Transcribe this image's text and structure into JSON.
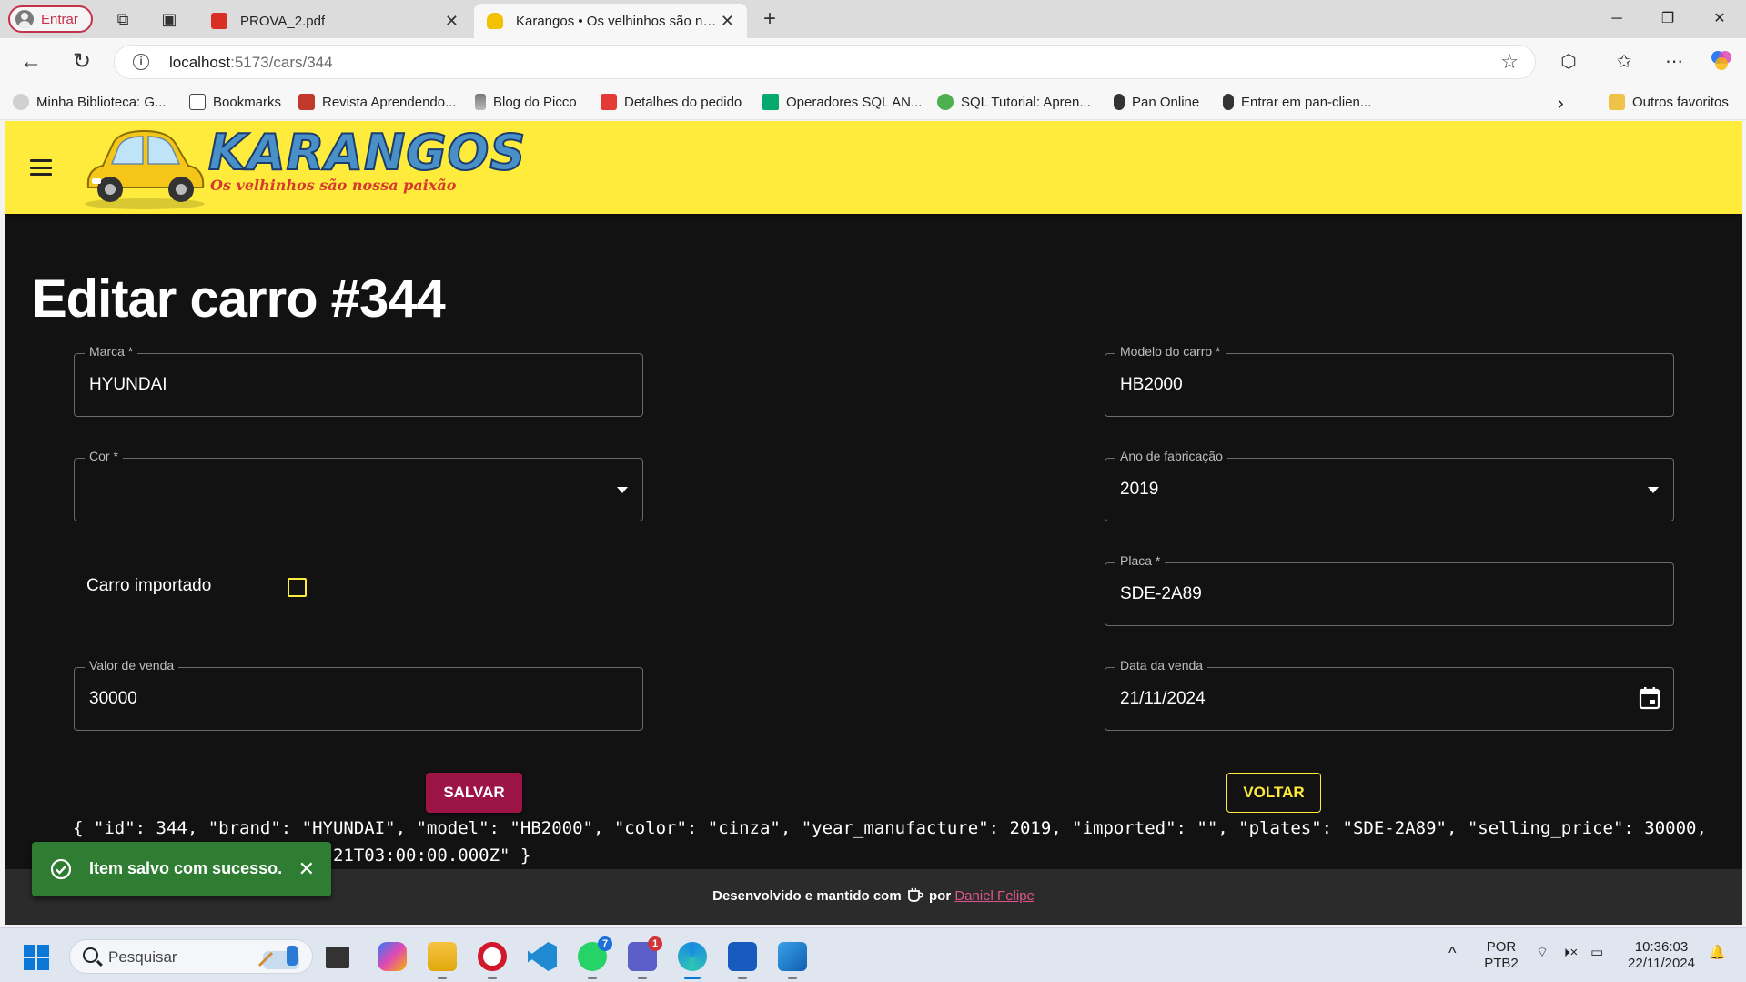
{
  "browser": {
    "profile_label": "Entrar",
    "tabs": [
      {
        "title": "PROVA_2.pdf",
        "active": false
      },
      {
        "title": "Karangos • Os velhinhos são nossa paixão",
        "active": true
      }
    ],
    "url_host": "localhost",
    "url_path": ":5173/cars/344",
    "bookmarks": [
      {
        "label": "Minha Biblioteca: G...",
        "icon": "cloud-icon"
      },
      {
        "label": "Bookmarks",
        "icon": "page-icon"
      },
      {
        "label": "Revista Aprendendo...",
        "icon": "book-icon"
      },
      {
        "label": "Blog do Picco",
        "icon": "tower-icon"
      },
      {
        "label": "Detalhes do pedido",
        "icon": "shop-icon"
      },
      {
        "label": "Operadores SQL AN...",
        "icon": "w3-icon"
      },
      {
        "label": "SQL Tutorial: Apren...",
        "icon": "sql-icon"
      },
      {
        "label": "Pan Online",
        "icon": "pan-icon"
      },
      {
        "label": "Entrar em pan-clien...",
        "icon": "pan-icon"
      }
    ],
    "other_favorites": "Outros favoritos"
  },
  "app": {
    "logo_title": "KARANGOS",
    "logo_subtitle": "Os velhinhos são nossa paixão",
    "page_title": "Editar carro #344",
    "form": {
      "brand_label": "Marca *",
      "brand_value": "HYUNDAI",
      "model_label": "Modelo do carro *",
      "model_value": "HB2000",
      "color_label": "Cor *",
      "color_value": "",
      "year_label": "Ano de fabricação",
      "year_value": "2019",
      "imported_label": "Carro importado",
      "imported_checked": false,
      "plates_label": "Placa *",
      "plates_value": "SDE-2A89",
      "price_label": "Valor de venda",
      "price_value": "30000",
      "date_label": "Data da venda",
      "date_value": "21/11/2024"
    },
    "save_button": "SALVAR",
    "back_button": "VOLTAR",
    "json_dump": "{ \"id\": 344, \"brand\": \"HYUNDAI\", \"model\": \"HB2000\", \"color\": \"cinza\", \"year_manufacture\": 2019, \"imported\": \"\", \"plates\": \"SDE-2A89\", \"selling_price\": 30000,\n                         21T03:00:00.000Z\" }",
    "footer_prefix": "Desenvolvido e mantido com",
    "footer_by": "por",
    "footer_author": "Daniel Felipe",
    "snackbar_message": "Item salvo com sucesso."
  },
  "taskbar": {
    "search_placeholder": "Pesquisar",
    "badges": {
      "whatsapp": "7",
      "teams": "1"
    },
    "lang_top": "POR",
    "lang_bottom": "PTB2",
    "time": "10:36:03",
    "date": "22/11/2024"
  },
  "colors": {
    "appbar": "#ffeb3b",
    "background": "#121212",
    "save": "#9c1345",
    "snackbar": "#2e7d32",
    "author_link": "#e0568a"
  }
}
